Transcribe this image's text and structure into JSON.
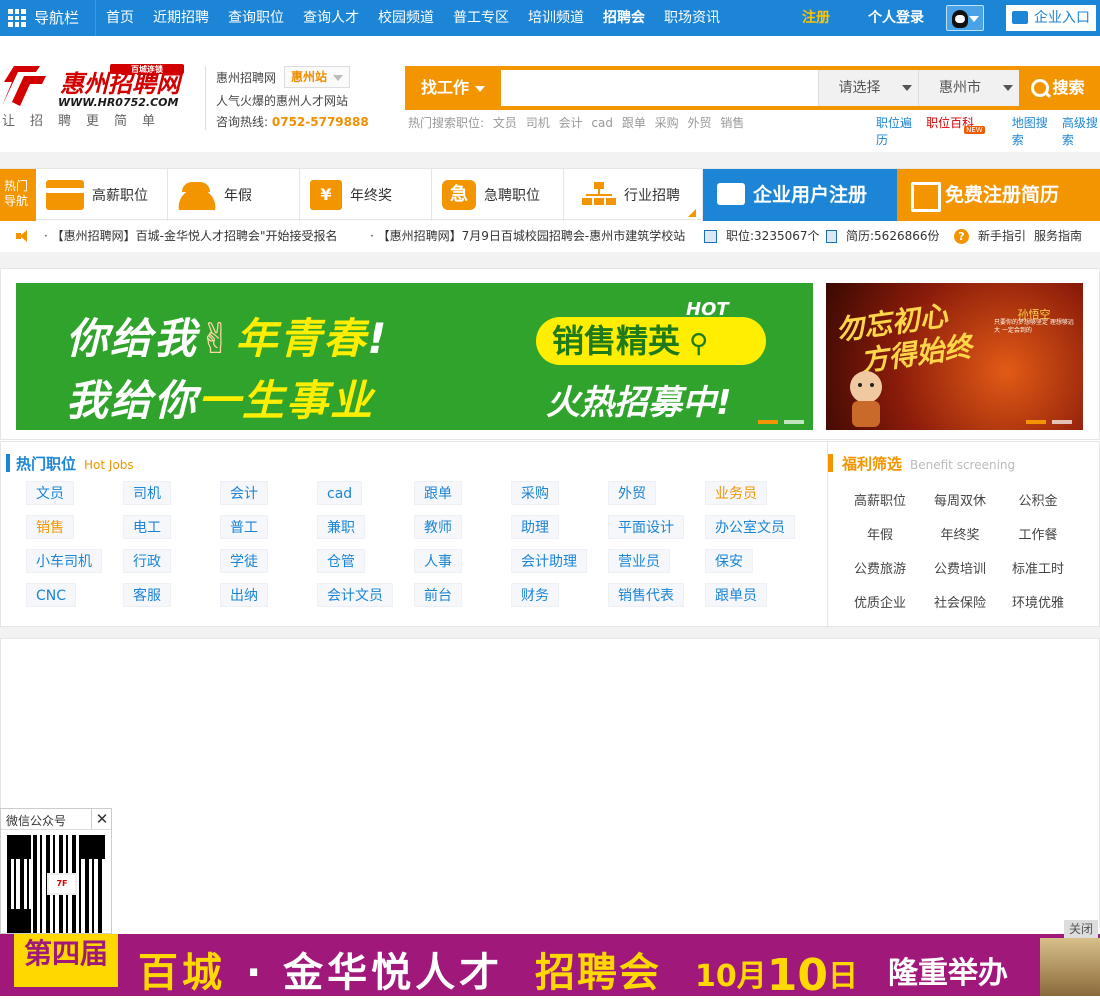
{
  "topnav": {
    "nav_label": "导航栏",
    "links": [
      "首页",
      "近期招聘",
      "查询职位",
      "查询人才",
      "校园频道",
      "普工专区",
      "培训频道",
      "招聘会",
      "职场资讯"
    ],
    "register": "注册",
    "personal_login": "个人登录",
    "enterprise_entry": "企业入口"
  },
  "header": {
    "logo_text": "惠州招聘网",
    "logo_badge": "百城连锁",
    "logo_url": "WWW.HR0752.COM",
    "slogan": "让招聘更简单",
    "site_name": "惠州招聘网",
    "station": "惠州站",
    "tagline": "人气火爆的惠州人才网站",
    "hotline_label": "咨询热线:",
    "hotline": "0752-5779888"
  },
  "search": {
    "type_label": "找工作",
    "input_value": "",
    "select_placeholder": "请选择",
    "city": "惠州市",
    "button_label": "搜索",
    "hot_label": "热门搜索职位:",
    "hot_terms": [
      "文员",
      "司机",
      "会计",
      "cad",
      "跟单",
      "采购",
      "外贸",
      "销售"
    ],
    "links": [
      "职位遍历",
      "职位百科",
      "地图搜索",
      "高级搜索"
    ],
    "new_badge": "NEW"
  },
  "categories": {
    "hot_nav": "热门导航",
    "items": [
      "高薪职位",
      "年假",
      "年终奖",
      "急聘职位",
      "行业招聘"
    ],
    "yen_glyph": "¥",
    "urgent_glyph": "急",
    "enterprise_register": "企业用户注册",
    "resume_register": "免费注册简历"
  },
  "notice": {
    "items": [
      "【惠州招聘网】百城-金华悦人才招聘会\"开始接受报名",
      "【惠州招聘网】7月9日百城校园招聘会-惠州市建筑学校站"
    ],
    "jobs_count": "职位:3235067个",
    "resumes_count": "简历:5626866份",
    "help_glyph": "?",
    "guide": "新手指引",
    "service": "服务指南"
  },
  "banner1": {
    "line1a": "你给我",
    "line1b": "年青春",
    "line2a": "我给你",
    "line2b": "一生事业",
    "pill": "销售精英",
    "hot": "HOT",
    "line3": "火热招募中!"
  },
  "banner2": {
    "title1": "勿忘初心",
    "title2": "方得始终",
    "signature": "孙悟空",
    "mini": "只要你的梦想够坚定 理想够远大 一定会到的"
  },
  "hot_jobs": {
    "title": "热门职位",
    "subtitle": "Hot Jobs",
    "rows": [
      [
        "文员",
        "司机",
        "会计",
        "cad",
        "跟单",
        "采购",
        "外贸",
        "业务员"
      ],
      [
        "销售",
        "电工",
        "普工",
        "兼职",
        "教师",
        "助理",
        "平面设计",
        "办公室文员"
      ],
      [
        "小车司机",
        "行政",
        "学徒",
        "仓管",
        "人事",
        "会计助理",
        "营业员",
        "保安"
      ],
      [
        "CNC",
        "客服",
        "出纳",
        "会计文员",
        "前台",
        "财务",
        "销售代表",
        "跟单员"
      ]
    ]
  },
  "welfare": {
    "title": "福利筛选",
    "subtitle": "Benefit screening",
    "rows": [
      [
        "高薪职位",
        "每周双休",
        "公积金"
      ],
      [
        "年假",
        "年终奖",
        "工作餐"
      ],
      [
        "公费旅游",
        "公费培训",
        "标准工时"
      ],
      [
        "优质企业",
        "社会保险",
        "环境优雅"
      ]
    ]
  },
  "wechat": {
    "title": "微信公众号",
    "close": "✕",
    "qr_logo": "7F"
  },
  "bottom_banner": {
    "edition": "第四届",
    "part1": "百城",
    "part2": "· 金华悦人才",
    "part3": "招聘会",
    "date_a": "10月",
    "date_b": "10",
    "date_c": "日",
    "part4": "隆重举办",
    "close": "关闭"
  },
  "colors": {
    "brand_blue": "#1c85d6",
    "brand_orange": "#f29500",
    "banner_green": "#2fa32b",
    "bottom_purple": "#a0187a"
  }
}
